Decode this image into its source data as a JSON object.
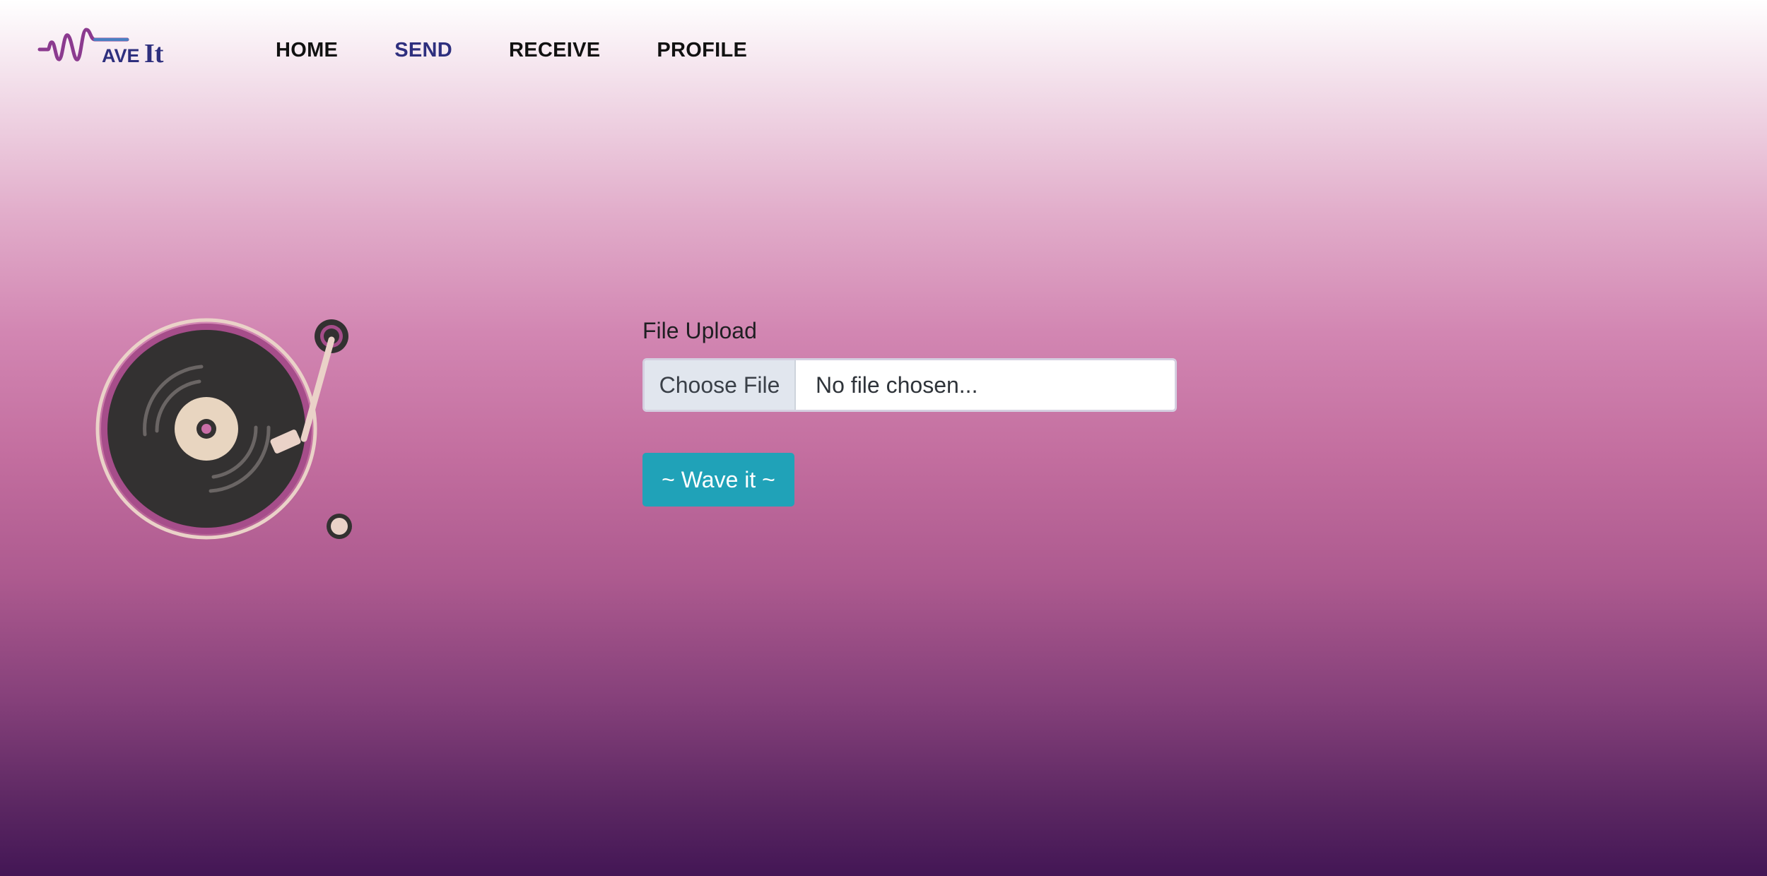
{
  "brand": {
    "logo_text_main": "AVE",
    "logo_text_end": "It",
    "colors": {
      "logo_wave": "#8b3a8f",
      "logo_text": "#2e2f7e",
      "logo_accent": "#4a7fc2"
    }
  },
  "nav": {
    "items": [
      {
        "label": "HOME",
        "active": false
      },
      {
        "label": "SEND",
        "active": true
      },
      {
        "label": "RECEIVE",
        "active": false
      },
      {
        "label": "PROFILE",
        "active": false
      }
    ]
  },
  "illustration": {
    "icon": "turntable-icon",
    "colors": {
      "record": "#333131",
      "label": "#e8d5c0",
      "rim": "#a64d8a",
      "outline": "#ead2c8"
    }
  },
  "upload": {
    "label": "File Upload",
    "choose_label": "Choose File",
    "status_text": "No file chosen..."
  },
  "actions": {
    "submit_label": "~ Wave it ~",
    "submit_color": "#20a2b8"
  }
}
